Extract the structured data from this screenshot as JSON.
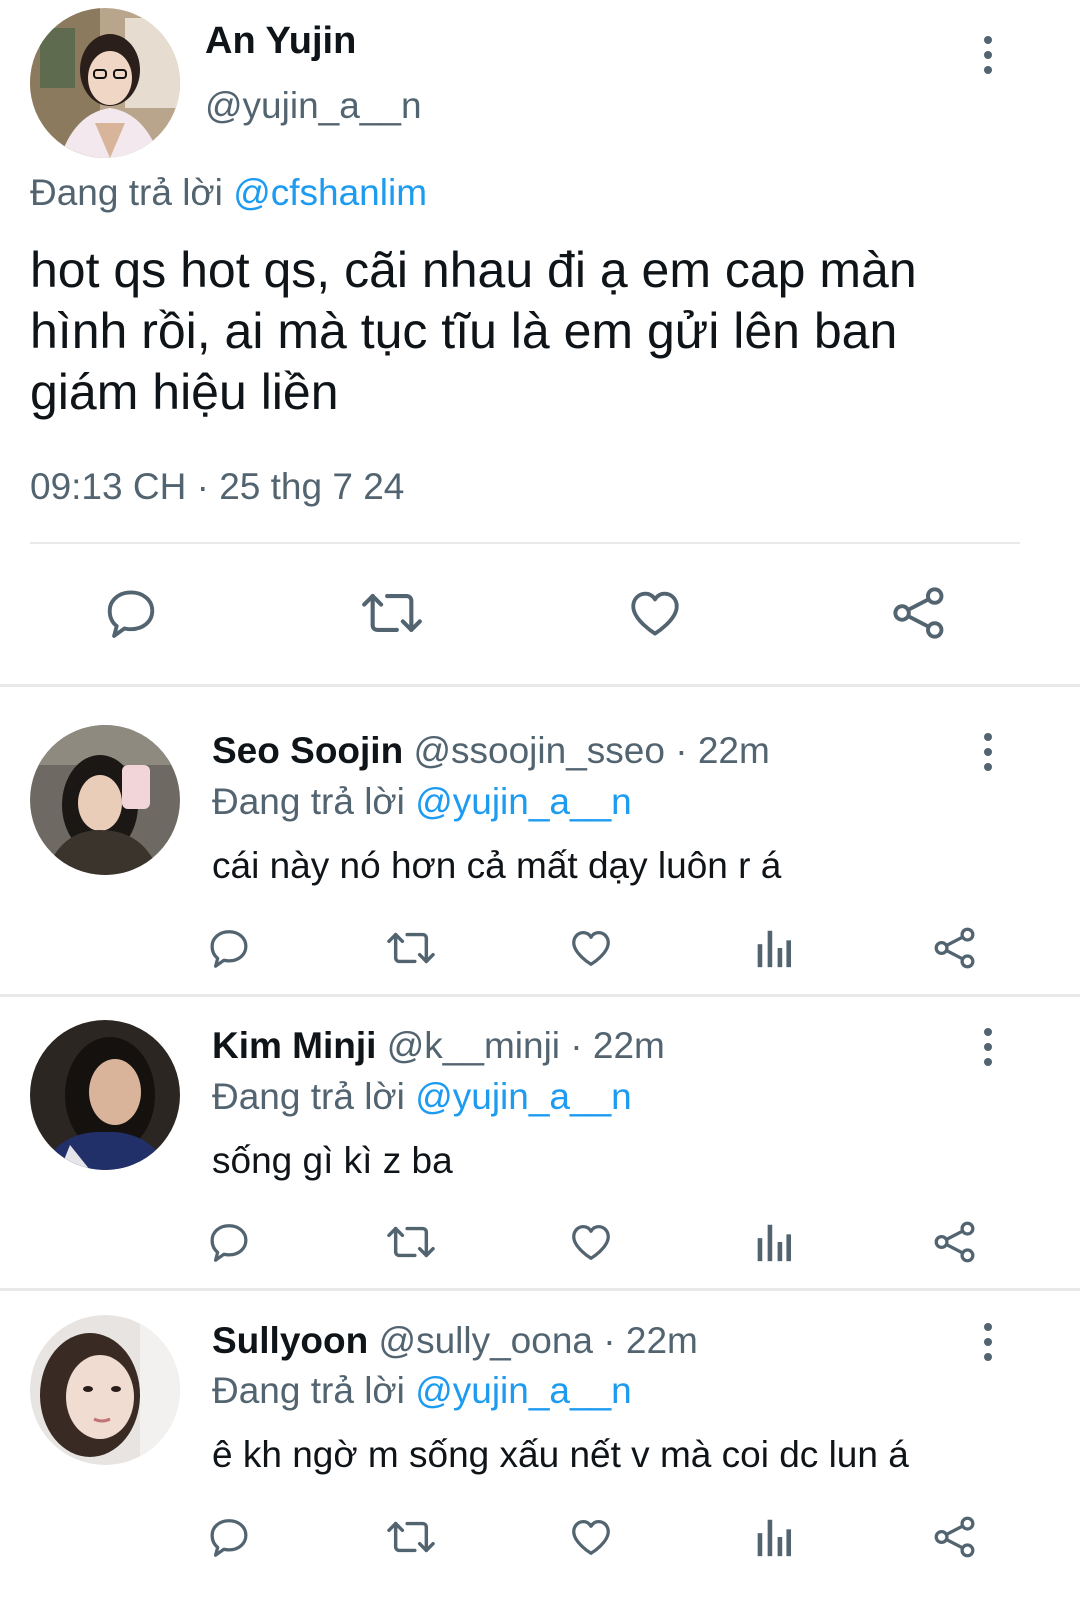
{
  "main_tweet": {
    "name": "An Yujin",
    "handle": "@yujin_a__n",
    "replying_prefix": "Đang trả lời",
    "replying_to": "@cfshanlim",
    "text_lines": [
      "hot qs hot qs, cãi nhau đi ạ em cap màn",
      "hình rồi, ai mà tục tĩu là em gửi lên ban",
      "giám hiệu liền"
    ],
    "timestamp": "09:13 CH · 25 thg 7 24"
  },
  "replies": [
    {
      "name": "Seo Soojin",
      "handle": "@ssoojin_sseo",
      "time": "· 22m",
      "replying_prefix": "Đang trả lời",
      "replying_to": "@yujin_a__n",
      "text": "cái này nó hơn cả mất dạy luôn r á"
    },
    {
      "name": "Kim Minji",
      "handle": "@k__minji",
      "time": "· 22m",
      "replying_prefix": "Đang trả lời",
      "replying_to": "@yujin_a__n",
      "text": "sống gì kì z ba"
    },
    {
      "name": "Sullyoon",
      "handle": "@sully_oona",
      "time": "· 22m",
      "replying_prefix": "Đang trả lời",
      "replying_to": "@yujin_a__n",
      "text": "ê kh ngờ m sống xấu nết v mà coi dc lun á"
    }
  ],
  "icons": {
    "reply": "comment-bubble-icon",
    "retweet": "retweet-icon",
    "like": "heart-icon",
    "views": "bar-chart-icon",
    "share": "share-icon",
    "more": "more-vertical-icon"
  },
  "colors": {
    "text": "#0f1419",
    "secondary": "#536471",
    "link": "#1d9bf0",
    "divider": "#e7e9ea"
  }
}
